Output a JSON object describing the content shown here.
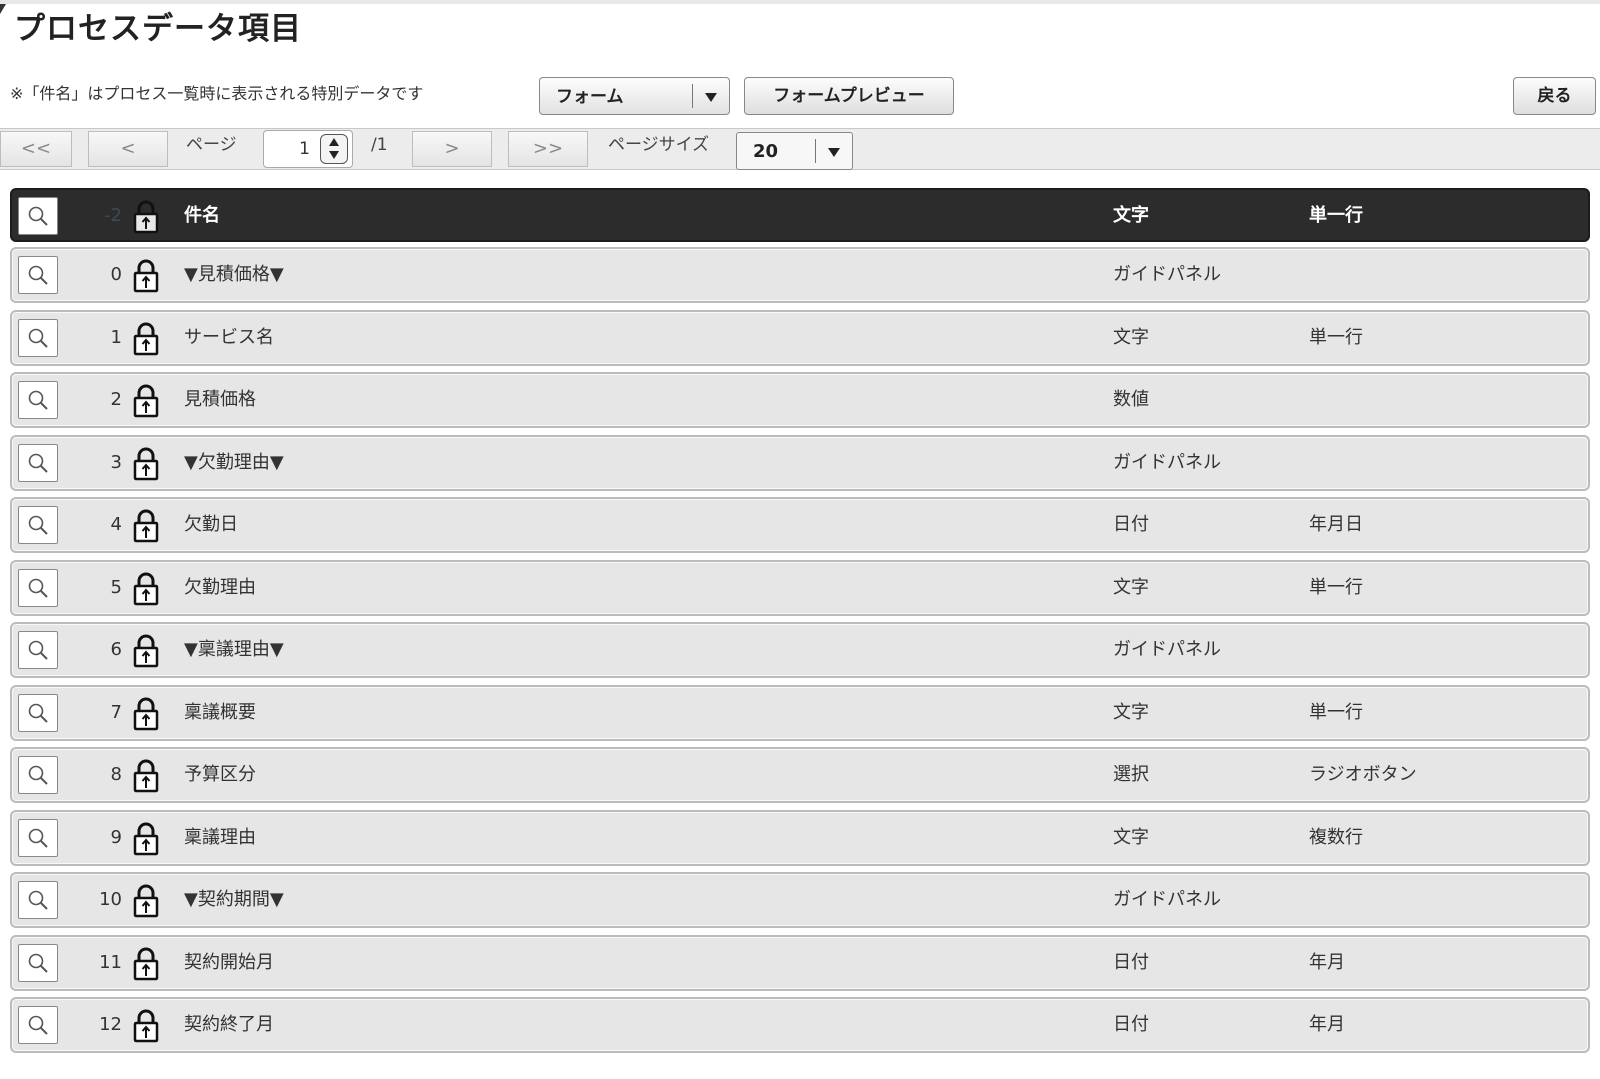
{
  "page": {
    "title": "プロセスデータ項目",
    "note": "※「件名」はプロセス一覧時に表示される特別データです"
  },
  "toolbar": {
    "form_select_value": "フォーム",
    "preview_label": "フォームプレビュー",
    "back_label": "戻る"
  },
  "pager": {
    "first": "<<",
    "prev": "<",
    "page_label": "ページ",
    "page_value": "1",
    "total": "/1",
    "next": ">",
    "last": ">>",
    "size_label": "ページサイズ",
    "size_value": "20"
  },
  "table": {
    "header": {
      "num": "-2",
      "name": "件名",
      "type": "文字",
      "sub": "単一行"
    },
    "rows": [
      {
        "num": "0",
        "name": "▼見積価格▼",
        "type": "ガイドパネル",
        "sub": ""
      },
      {
        "num": "1",
        "name": "サービス名",
        "type": "文字",
        "sub": "単一行"
      },
      {
        "num": "2",
        "name": "見積価格",
        "type": "数値",
        "sub": ""
      },
      {
        "num": "3",
        "name": "▼欠勤理由▼",
        "type": "ガイドパネル",
        "sub": ""
      },
      {
        "num": "4",
        "name": "欠勤日",
        "type": "日付",
        "sub": "年月日"
      },
      {
        "num": "5",
        "name": "欠勤理由",
        "type": "文字",
        "sub": "単一行"
      },
      {
        "num": "6",
        "name": "▼稟議理由▼",
        "type": "ガイドパネル",
        "sub": ""
      },
      {
        "num": "7",
        "name": "稟議概要",
        "type": "文字",
        "sub": "単一行"
      },
      {
        "num": "8",
        "name": "予算区分",
        "type": "選択",
        "sub": "ラジオボタン"
      },
      {
        "num": "9",
        "name": "稟議理由",
        "type": "文字",
        "sub": "複数行"
      },
      {
        "num": "10",
        "name": "▼契約期間▼",
        "type": "ガイドパネル",
        "sub": ""
      },
      {
        "num": "11",
        "name": "契約開始月",
        "type": "日付",
        "sub": "年月"
      },
      {
        "num": "12",
        "name": "契約終了月",
        "type": "日付",
        "sub": "年月"
      }
    ]
  }
}
